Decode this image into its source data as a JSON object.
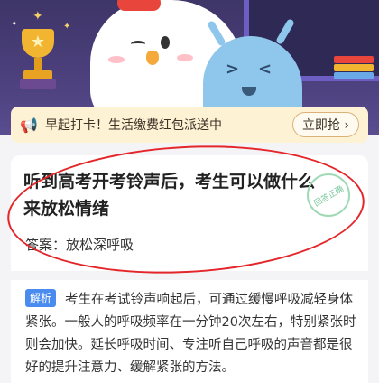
{
  "banner": {
    "text": "早起打卡！生活缴费红包派送中",
    "button_label": "立即抢",
    "chevron": "›"
  },
  "question": {
    "title": "听到高考开考铃声后，考生可以做什么来放松情绪",
    "stamp_text": "回答正确"
  },
  "answer": {
    "label": "答案：",
    "value": "放松深呼吸"
  },
  "analysis": {
    "tag": "解析",
    "text": "考生在考试铃声响起后，可通过缓慢呼吸减轻身体紧张。一般人的呼吸频率在一分钟20次左右，特别紧张时则会加快。延长呼吸时间、专注听自己呼吸的声音都是很好的提升注意力、缓解紧张的方法。"
  },
  "colors": {
    "hero_bg": "#4f4382",
    "banner_bg": "#fdf2d4",
    "tag_bg": "#4a8bef",
    "highlight_oval": "#e4262a"
  }
}
